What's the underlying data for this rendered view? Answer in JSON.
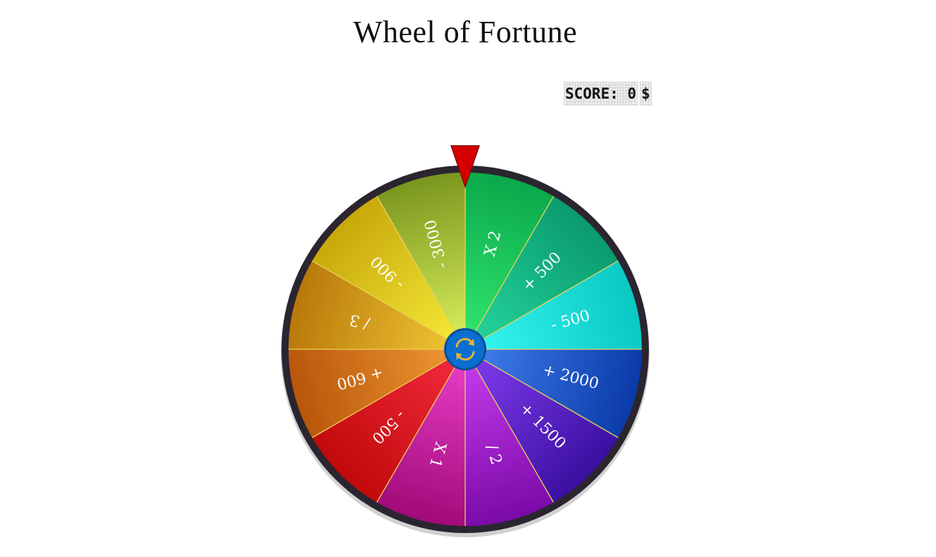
{
  "page": {
    "title": "Wheel of Fortune"
  },
  "score": {
    "label": "SCORE: 0",
    "currency": "$"
  },
  "wheel": {
    "segments": [
      {
        "label": "X 2",
        "color_light": "#2fe36c",
        "color_dark": "#0aa84a"
      },
      {
        "label": "+ 500",
        "color_light": "#23d29a",
        "color_dark": "#0a9a6e"
      },
      {
        "label": "- 500",
        "color_light": "#35f3ef",
        "color_dark": "#09c8c4"
      },
      {
        "label": "+ 2000",
        "color_light": "#3d7be8",
        "color_dark": "#0a3aa8"
      },
      {
        "label": "+ 1500",
        "color_light": "#7d3aea",
        "color_dark": "#3a0fa0"
      },
      {
        "label": "/ 2",
        "color_light": "#c23ae8",
        "color_dark": "#7a0aa8"
      },
      {
        "label": "X 1",
        "color_light": "#e63bc4",
        "color_dark": "#a00a78"
      },
      {
        "label": "- 500",
        "color_light": "#f0283a",
        "color_dark": "#c00a0a"
      },
      {
        "label": "+ 600",
        "color_light": "#ec9431",
        "color_dark": "#b8560a"
      },
      {
        "label": "/ 3",
        "color_light": "#eec232",
        "color_dark": "#b8780a"
      },
      {
        "label": "- 900",
        "color_light": "#f3e635",
        "color_dark": "#c8a80a"
      },
      {
        "label": "- 3000",
        "color_light": "#d4ea58",
        "color_dark": "#7a961e"
      }
    ],
    "rim_color": "#2b2530",
    "divider_color": "#e8d25a",
    "pointer_color": "#d40000",
    "hub_color": "#0a6fd0",
    "hub_icon": "refresh-icon",
    "hub_icon_color": "#e3b23a"
  }
}
